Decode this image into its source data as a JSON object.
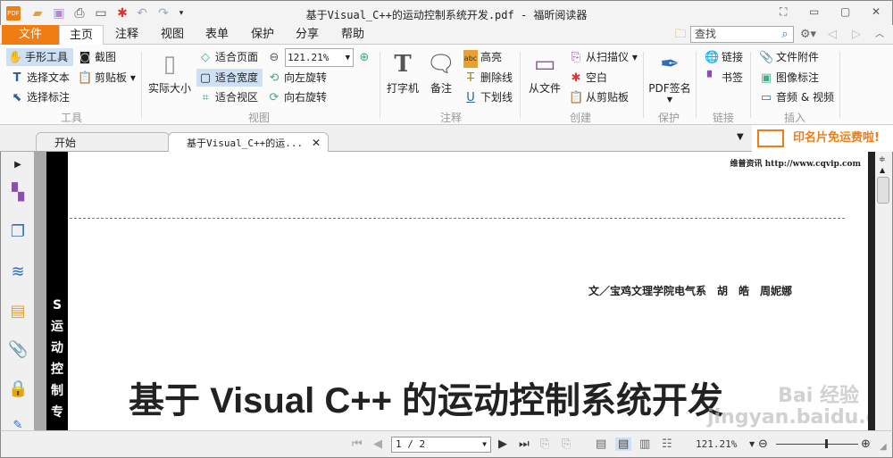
{
  "window": {
    "title": "基于Visual_C++的运动控制系统开发.pdf - 福昕阅读器"
  },
  "menu": {
    "file": "文件",
    "tabs": [
      "主页",
      "注释",
      "视图",
      "表单",
      "保护",
      "分享",
      "帮助"
    ],
    "search_placeholder": "查找"
  },
  "ribbon": {
    "tools": {
      "hand": "手形工具",
      "screenshot": "截图",
      "select_text": "选择文本",
      "clipboard": "剪贴板",
      "select_annot": "选择标注",
      "group": "工具"
    },
    "view": {
      "actual_size": "实际大小",
      "fit_page": "适合页面",
      "fit_width": "适合宽度",
      "fit_visible": "适合视区",
      "zoom": "121.21%",
      "rotate_left": "向左旋转",
      "rotate_right": "向右旋转",
      "group": "视图"
    },
    "comment": {
      "typewriter": "打字机",
      "note": "备注",
      "highlight": "高亮",
      "strikeout": "删除线",
      "underline": "下划线",
      "group": "注释"
    },
    "create": {
      "from_file": "从文件",
      "from_scanner": "从扫描仪",
      "blank": "空白",
      "from_clipboard": "从剪贴板",
      "group": "创建"
    },
    "protect": {
      "pdf_sign": "PDF签名",
      "group": "保护"
    },
    "links": {
      "link": "链接",
      "bookmark": "书签",
      "group": "链接"
    },
    "insert": {
      "attachment": "文件附件",
      "image_annot": "图像标注",
      "audio_video": "音频 & 视频",
      "group": "插入"
    }
  },
  "doc_tabs": [
    {
      "label": "开始"
    },
    {
      "label": "基于Visual_C++的运..."
    }
  ],
  "ad": "印名片免运费啦!",
  "document": {
    "header": "维普资讯 http://www.cqvip.com",
    "authors": "文／宝鸡文理学院电气系　胡　皓　周妮娜",
    "title": "基于 Visual C++ 的运动控制系统开发",
    "side_strip": "S 运 动 控 制 专"
  },
  "status": {
    "page": "1 / 2",
    "zoom": "121.21%",
    "zoom_fraction": 0.6
  },
  "watermark": "Bai 经验 jingyan.baidu.com"
}
